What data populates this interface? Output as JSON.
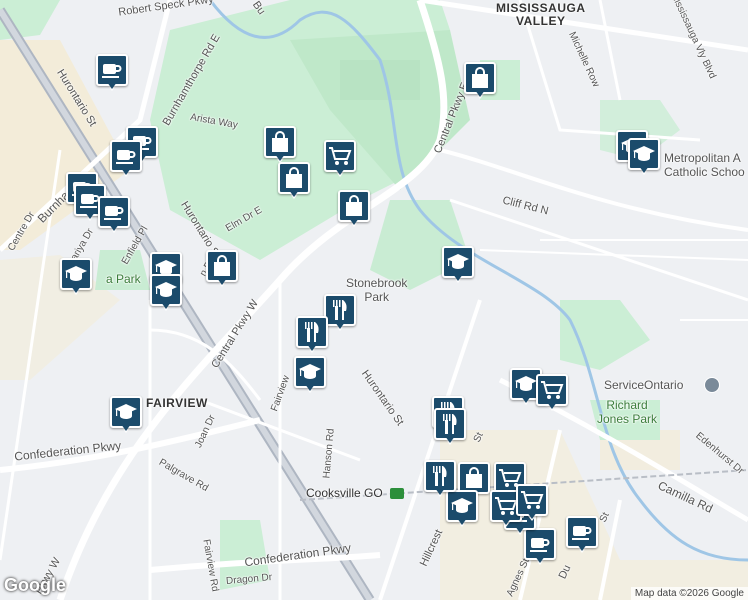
{
  "map": {
    "labels": {
      "mississauga_valley": "MISSISSAUGA\nVALLEY",
      "fairview": "FAIRVIEW",
      "stonebrook_park": "Stonebrook\nPark",
      "cooksville_go": "Cooksville GO",
      "service_ontario": "ServiceOntario",
      "richard_jones_park": "Richard\nJones Park",
      "metropolitan_school": "Metropolitan A\nCatholic Schoo",
      "robert_speck": "Robert Speck Pkwy",
      "hurontario_top": "Hurontario St",
      "hurontario_mid": "Hurontario St",
      "hurontario_bottom": "Hurontario St",
      "central_pkwy_e": "Central Pkwy E",
      "central_pkwy_w": "Central Pkwy W",
      "cliff_rd_n": "Cliff Rd N",
      "confederation_left": "Confederation Pkwy",
      "confederation_bottom": "Confederation Pkwy",
      "camilla_rd": "Camilla Rd",
      "edenhurst": "Edenhurst Dr",
      "hillcrest": "Hillcrest",
      "hanson": "Hanson Rd",
      "joan": "Joan Dr",
      "palgrave": "Palgrave Rd",
      "dragon": "Dragon Dr",
      "fairview_rd": "Fairview",
      "fairview_rd2": "Fairview Rd",
      "elm": "Elm Dr E",
      "arista": "Arista Way",
      "burnhamthorpe": "Burnhamthorpe Rd E",
      "burnhamthorpe_left": "Burnha",
      "kariya": "Kariya Dr",
      "enfield": "Enfield Pl",
      "centre": "Centre Dr",
      "michelle": "Michelle Row",
      "mississauga_blvd": "Mississauga Vly Blvd",
      "agnes": "Agnes St",
      "duke": "Du",
      "st": "St",
      "bu": "Bu",
      "pkwy_w": "Pkwy W",
      "park": "a Park",
      "an_dr": "n Dr",
      "st2": "St"
    },
    "attribution": "Map data ©2026 Google",
    "logo": "Google"
  }
}
